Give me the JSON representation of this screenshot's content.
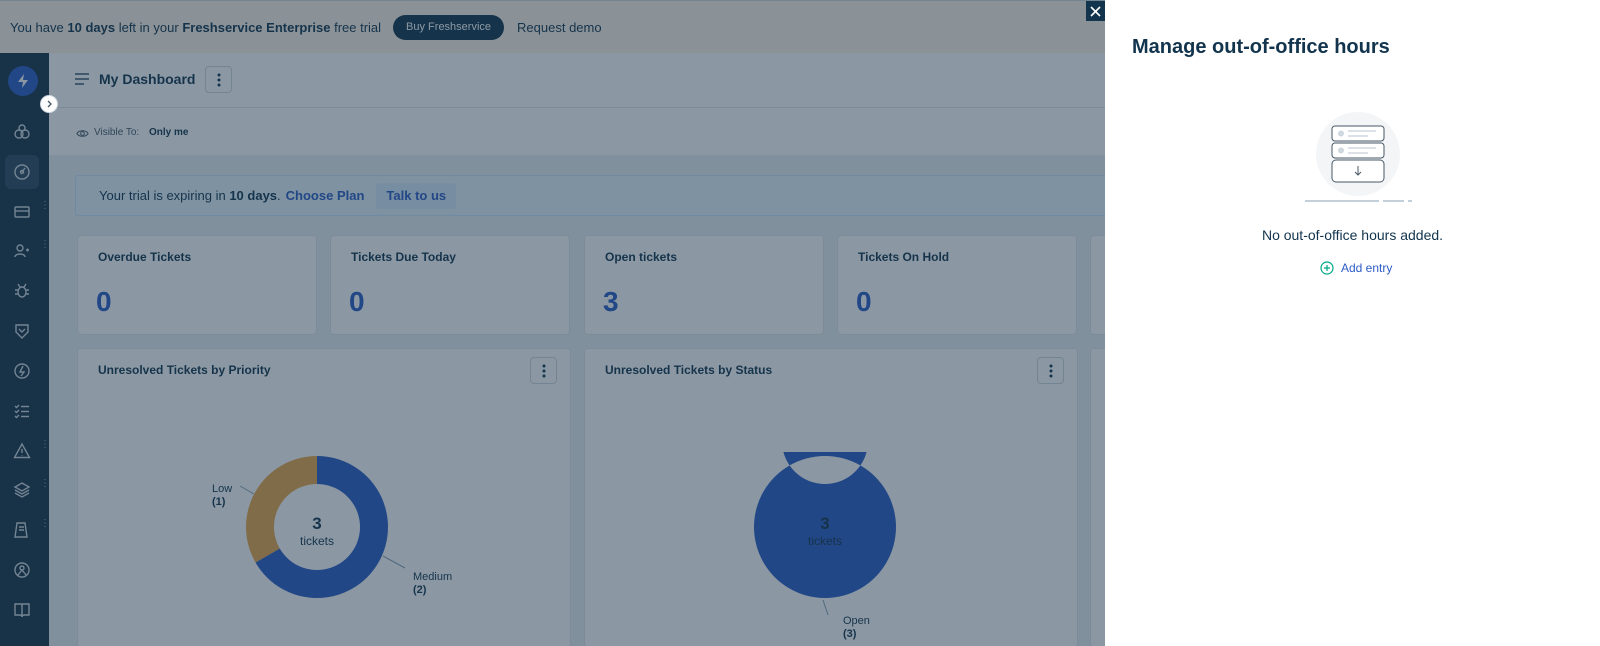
{
  "trial_bar": {
    "prefix": "You have",
    "days": "10 days",
    "middle": "left in your",
    "product": "Freshservice Enterprise",
    "suffix": "free trial",
    "buy_label": "Buy Freshservice",
    "demo_label": "Request demo"
  },
  "header": {
    "title": "My Dashboard",
    "visible_to_label": "Visible To:",
    "visible_to_value": "Only me"
  },
  "nav": {
    "items": [
      "logo-icon",
      "team-icon",
      "dashboard-icon",
      "tickets-icon",
      "contacts-icon",
      "problems-icon",
      "changes-icon",
      "releases-icon",
      "tasks-icon",
      "alerts-icon",
      "assets-icon",
      "purchase-icon",
      "projects-icon",
      "solutions-icon"
    ]
  },
  "trial_banner": {
    "prefix": "Your trial is expiring in",
    "days": "10 days",
    "period": ".",
    "plan_link": "Choose Plan",
    "talk_label": "Talk to us"
  },
  "stats": [
    {
      "label": "Overdue Tickets",
      "value": "0"
    },
    {
      "label": "Tickets Due Today",
      "value": "0"
    },
    {
      "label": "Open tickets",
      "value": "3"
    },
    {
      "label": "Tickets On Hold",
      "value": "0"
    }
  ],
  "widgets": [
    {
      "title": "Unresolved Tickets by Priority",
      "center_value": "3",
      "center_unit": "tickets",
      "labels": [
        {
          "name": "Low",
          "count": "(1)"
        },
        {
          "name": "Medium",
          "count": "(2)"
        }
      ]
    },
    {
      "title": "Unresolved Tickets by Status",
      "center_value": "3",
      "center_unit": "tickets",
      "labels": [
        {
          "name": "Open",
          "count": "(3)"
        }
      ]
    }
  ],
  "chart_data": [
    {
      "type": "pie",
      "title": "Unresolved Tickets by Priority",
      "categories": [
        "Low",
        "Medium"
      ],
      "values": [
        1,
        2
      ],
      "colors": [
        "#e8a64a",
        "#2c5cc5"
      ],
      "gradient_low": [
        "#f0c05a",
        "#e07a3a"
      ],
      "center_label": "3 tickets"
    },
    {
      "type": "pie",
      "title": "Unresolved Tickets by Status",
      "categories": [
        "Open"
      ],
      "values": [
        3
      ],
      "colors": [
        "#2c5cc5"
      ],
      "center_label": "3 tickets"
    }
  ],
  "panel": {
    "title": "Manage out-of-office hours",
    "empty_text": "No out-of-office hours added.",
    "add_label": "Add entry"
  },
  "colors": {
    "brand": "#2c5cc5",
    "navy": "#12344d",
    "add_icon": "#00a886"
  }
}
